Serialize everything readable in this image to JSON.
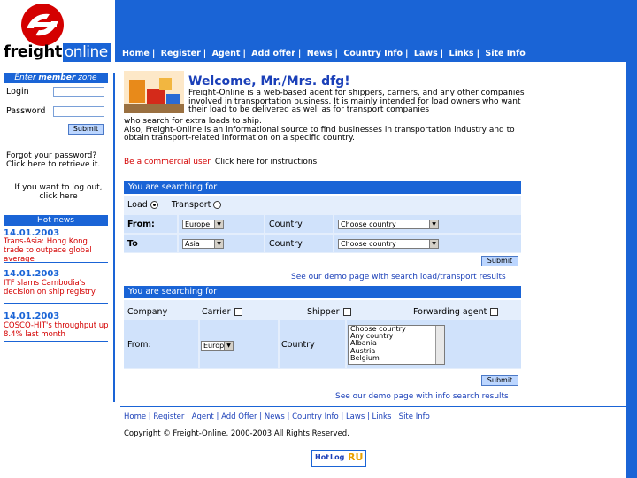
{
  "header": {
    "logo_text_a": "freight",
    "logo_text_b": "online",
    "nav": [
      "Home",
      "Register",
      "Agent",
      "Add offer",
      "News",
      "Country Info",
      "Laws",
      "Links",
      "Site Info"
    ]
  },
  "login": {
    "title_a": "Enter ",
    "title_b": "member",
    "title_c": " zone",
    "login_label": "Login",
    "password_label": "Password",
    "login_value": "",
    "password_value": "",
    "submit": "Submit",
    "forgot": "Forgot your password? Click here to retrieve it.",
    "logout": "If you want to log out, click here"
  },
  "news": {
    "title": "Hot news",
    "items": [
      {
        "date": "14.01.2003",
        "text": "Trans-Asia: Hong Kong trade to outpace global average"
      },
      {
        "date": "14.01.2003",
        "text": "ITF slams Cambodia's decision on ship registry"
      },
      {
        "date": "14.01.2003",
        "text": "COSCO-HIT's throughput up 8.4% last month"
      }
    ]
  },
  "main": {
    "welcome": "Welcome, Mr./Mrs. dfg!",
    "intro_1": "Freight-Online is a web-based agent for shippers, carriers, and any other companies involved in transportation business. It is mainly intended for load owners who want their load to be delivered as well as for transport companies",
    "intro_2": "who search for extra loads to ship.",
    "intro_3": "Also, Freight-Online is an informational source to find businesses in transportation industry and to obtain transport-related information on a specific country.",
    "commercial_a": "Be a commercial user.",
    "commercial_b": " Click here for instructions"
  },
  "search1": {
    "head": "You are searching for",
    "load_label": "Load",
    "transport_label": "Transport",
    "from_label": "From:",
    "to_label": "To",
    "country_label": "Country",
    "from_region": "Europe",
    "to_region": "Asia",
    "country_from": "Choose country",
    "country_to": "Choose country",
    "submit": "Submit",
    "demo_link": "See our demo page with search load/transport results"
  },
  "search2": {
    "head": "You are searching for",
    "company_label": "Company",
    "carrier_label": "Carrier",
    "shipper_label": "Shipper",
    "forwarding_label": "Forwarding agent",
    "from_label": "From:",
    "from_region": "Europe",
    "country_label": "Country",
    "country_options": [
      "Choose country",
      "Any country",
      "Albania",
      "Austria",
      "Belgium"
    ],
    "submit": "Submit",
    "demo_link": "See our demo page with info search results"
  },
  "footer": {
    "nav": [
      "Home",
      "Register",
      "Agent",
      "Add Offer",
      "News",
      "Country Info",
      "Laws",
      "Links",
      "Site Info"
    ],
    "copyright": "Copyright © Freight-Online, 2000-2003 All Rights Reserved.",
    "badge_a": "Hot",
    "badge_b": "Log",
    "badge_c": "RU"
  },
  "colors": {
    "brand_blue": "#1a64d6",
    "red": "#d40000",
    "panel": "#e4eefc"
  }
}
